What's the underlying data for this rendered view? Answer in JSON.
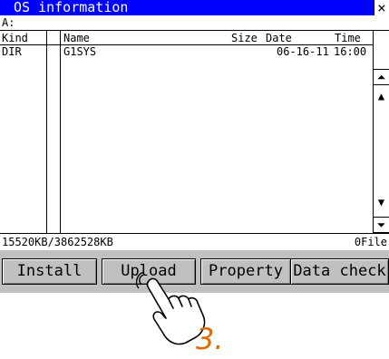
{
  "window": {
    "title": "OS information",
    "close_label": "×"
  },
  "drive": "A:",
  "table": {
    "headers": {
      "kind": "Kind",
      "name": "Name",
      "size": "Size",
      "date": "Date",
      "time": "Time"
    },
    "rows": [
      {
        "kind": "DIR",
        "name": "G1SYS",
        "size": "",
        "date": "06-16-11",
        "time": "16:00"
      }
    ]
  },
  "scrollbar": {
    "top": "⏶",
    "up": "▲",
    "down": "▼",
    "bottom": "⏷"
  },
  "status": {
    "capacity": "15520KB/3862528KB",
    "file_count": "0File"
  },
  "buttons": {
    "install": "Install",
    "upload": "Upload",
    "property": "Property",
    "data_check": "Data check"
  },
  "callout": {
    "step": "3.",
    "color": "#e06a00"
  },
  "colors": {
    "titlebar": "#0000ff",
    "buttonbar": "#c0c0c0"
  }
}
